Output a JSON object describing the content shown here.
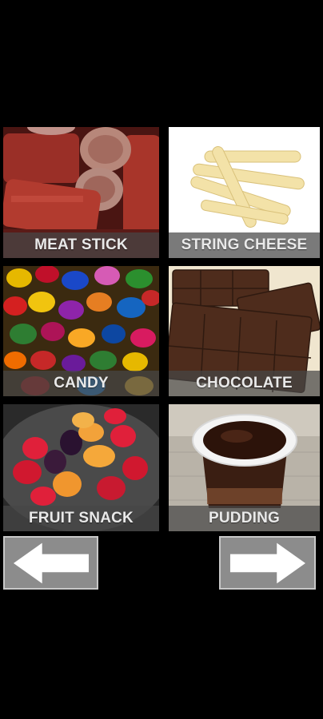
{
  "tiles": [
    {
      "label": "MEAT STICK"
    },
    {
      "label": "STRING CHEESE"
    },
    {
      "label": "CANDY"
    },
    {
      "label": "CHOCOLATE"
    },
    {
      "label": "FRUIT SNACK"
    },
    {
      "label": "PUDDING"
    }
  ],
  "nav": {
    "back_icon": "left-arrow-icon",
    "next_icon": "right-arrow-icon"
  },
  "colors": {
    "background": "#000000",
    "caption_bg": "#464646",
    "caption_text": "#e9e9e9",
    "nav_button": "#8c8c8c",
    "arrow": "#ffffff"
  }
}
